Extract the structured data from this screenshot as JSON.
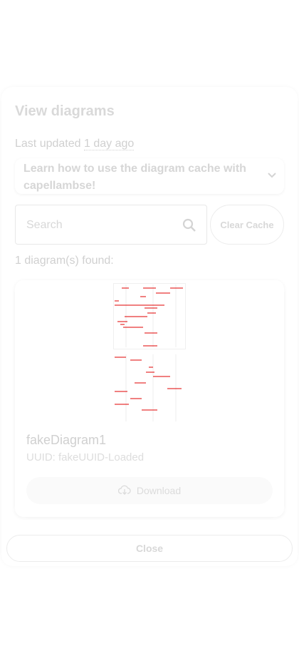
{
  "dialog": {
    "title": "View diagrams",
    "last_updated_label": "Last updated",
    "last_updated_value": "1 day ago",
    "accordion_label": "Learn how to use the diagram cache with capellambse!",
    "search_placeholder": "Search",
    "clear_cache_label": "Clear Cache",
    "found_text": "1 diagram(s) found:",
    "close_label": "Close"
  },
  "diagrams": [
    {
      "name": "fakeDiagram1",
      "uuid_text": "UUID: fakeUUID-Loaded",
      "download_label": "Download"
    }
  ],
  "colors": {
    "diagram_lines": "#e00000",
    "text_faded": "#d4d4d4"
  },
  "icons": {
    "accordion": "chevron-down-icon",
    "search": "search-icon",
    "download": "cloud-download-icon"
  }
}
